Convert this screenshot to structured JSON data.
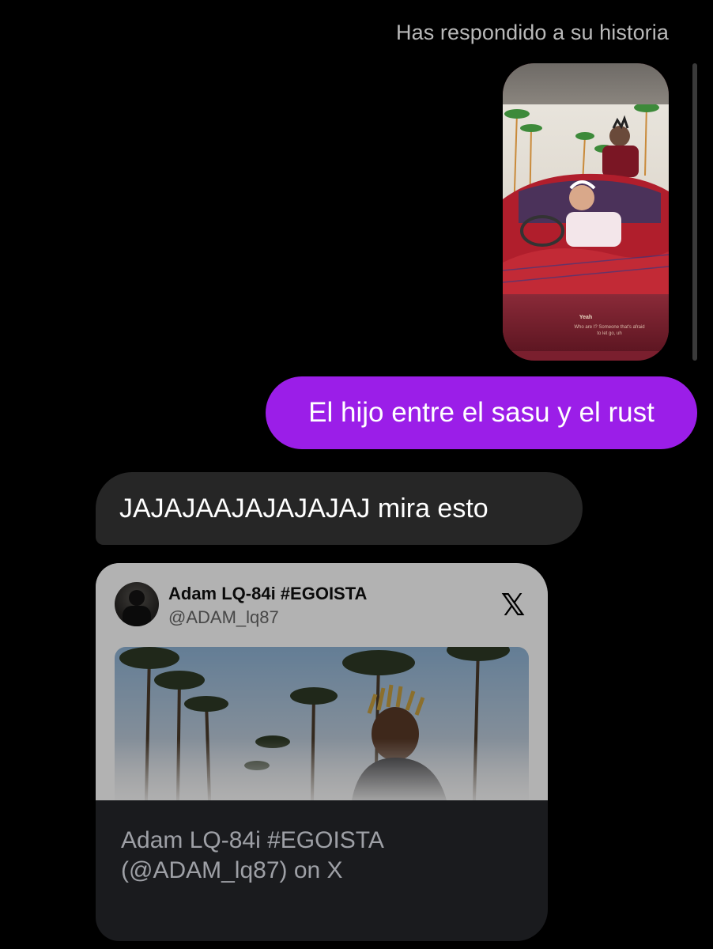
{
  "reply_meta": "Has respondido a su historia",
  "story": {
    "caption_title": "Yeah",
    "caption_text": "Who are I? Someone that's afraid to let go, uh"
  },
  "sent_message": "El hijo entre el sasu y el rust",
  "received_message": "JAJAJAAJAJAJAJAJ mira esto",
  "link_card": {
    "author_name": "Adam LQ-84i #EGOISTA",
    "author_handle": "@ADAM_lq87",
    "platform_icon": "x-logo-icon",
    "platform_glyph": "𝕏",
    "title": "Adam LQ-84i #EGOISTA (@ADAM_lq87) on X"
  },
  "colors": {
    "background": "#000000",
    "sent_bubble": "#9b1ee8",
    "received_bubble": "#262626",
    "link_card_bg": "#1a1b1e"
  }
}
